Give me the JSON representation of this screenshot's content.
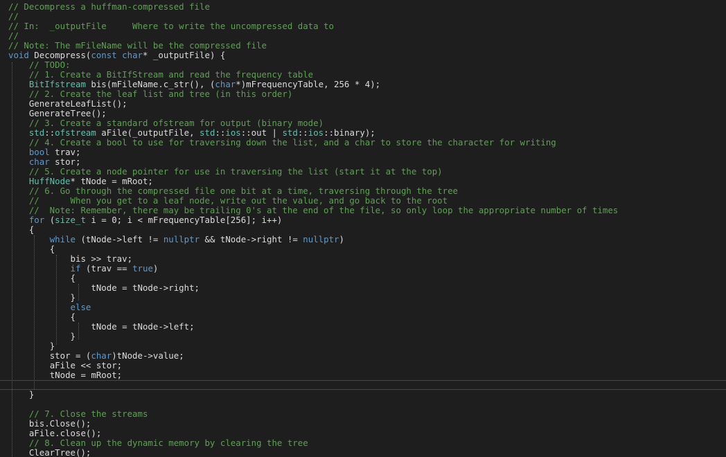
{
  "editor": {
    "theme_colors": {
      "background": "#1e1e1e",
      "comment": "#57a64a",
      "keyword": "#569cd6",
      "type": "#4ec9b0",
      "text": "#dcdcdc",
      "current_line_border": "#464646"
    },
    "current_line_index": 39,
    "lines": [
      {
        "indent": "",
        "tokens": [
          {
            "t": "// Decompress a huffman-compressed file",
            "c": "comment"
          }
        ]
      },
      {
        "indent": "",
        "tokens": [
          {
            "t": "//",
            "c": "comment"
          }
        ]
      },
      {
        "indent": "",
        "tokens": [
          {
            "t": "// In:  _outputFile     Where to write the uncompressed data to",
            "c": "comment"
          }
        ]
      },
      {
        "indent": "",
        "tokens": [
          {
            "t": "//",
            "c": "comment"
          }
        ]
      },
      {
        "indent": "",
        "tokens": [
          {
            "t": "// Note: The mFileName will be the compressed file",
            "c": "comment"
          }
        ]
      },
      {
        "indent": "",
        "tokens": [
          {
            "t": "void",
            "c": "keyword"
          },
          {
            "t": " Decompress(",
            "c": "text"
          },
          {
            "t": "const",
            "c": "keyword"
          },
          {
            "t": " ",
            "c": "text"
          },
          {
            "t": "char",
            "c": "keyword"
          },
          {
            "t": "* _outputFile) {",
            "c": "text"
          }
        ]
      },
      {
        "indent": "    ",
        "tokens": [
          {
            "t": "// TODO:",
            "c": "comment"
          }
        ]
      },
      {
        "indent": "    ",
        "tokens": [
          {
            "t": "// 1. Create a BitIfStream and read the frequency table",
            "c": "comment"
          }
        ]
      },
      {
        "indent": "    ",
        "tokens": [
          {
            "t": "BitIfstream",
            "c": "type"
          },
          {
            "t": " bis(mFileName.c_str(), (",
            "c": "text"
          },
          {
            "t": "char",
            "c": "keyword"
          },
          {
            "t": "*)mFrequencyTable, 256 * 4);",
            "c": "text"
          }
        ]
      },
      {
        "indent": "    ",
        "tokens": [
          {
            "t": "// 2. Create the leaf list and tree (in this order)",
            "c": "comment"
          }
        ]
      },
      {
        "indent": "    ",
        "tokens": [
          {
            "t": "GenerateLeafList();",
            "c": "text"
          }
        ]
      },
      {
        "indent": "    ",
        "tokens": [
          {
            "t": "GenerateTree();",
            "c": "text"
          }
        ]
      },
      {
        "indent": "    ",
        "tokens": [
          {
            "t": "// 3. Create a standard ofstream for output (binary mode)",
            "c": "comment"
          }
        ]
      },
      {
        "indent": "    ",
        "tokens": [
          {
            "t": "std",
            "c": "type"
          },
          {
            "t": "::",
            "c": "text"
          },
          {
            "t": "ofstream",
            "c": "type"
          },
          {
            "t": " aFile(_outputFile, ",
            "c": "text"
          },
          {
            "t": "std",
            "c": "type"
          },
          {
            "t": "::",
            "c": "text"
          },
          {
            "t": "ios",
            "c": "type"
          },
          {
            "t": "::out | ",
            "c": "text"
          },
          {
            "t": "std",
            "c": "type"
          },
          {
            "t": "::",
            "c": "text"
          },
          {
            "t": "ios",
            "c": "type"
          },
          {
            "t": "::binary);",
            "c": "text"
          }
        ]
      },
      {
        "indent": "    ",
        "tokens": [
          {
            "t": "// 4. Create a bool to use for traversing down the list, and a char to store the character for writing",
            "c": "comment"
          }
        ]
      },
      {
        "indent": "    ",
        "tokens": [
          {
            "t": "bool",
            "c": "keyword"
          },
          {
            "t": " trav;",
            "c": "text"
          }
        ]
      },
      {
        "indent": "    ",
        "tokens": [
          {
            "t": "char",
            "c": "keyword"
          },
          {
            "t": " stor;",
            "c": "text"
          }
        ]
      },
      {
        "indent": "    ",
        "tokens": [
          {
            "t": "// 5. Create a node pointer for use in traversing the list (start it at the top)",
            "c": "comment"
          }
        ]
      },
      {
        "indent": "    ",
        "tokens": [
          {
            "t": "HuffNode",
            "c": "type"
          },
          {
            "t": "* tNode = mRoot;",
            "c": "text"
          }
        ]
      },
      {
        "indent": "    ",
        "tokens": [
          {
            "t": "// 6. Go through the compressed file one bit at a time, traversing through the tree",
            "c": "comment"
          }
        ]
      },
      {
        "indent": "    ",
        "tokens": [
          {
            "t": "//      When you get to a leaf node, write out the value, and go back to the root",
            "c": "comment"
          }
        ]
      },
      {
        "indent": "    ",
        "tokens": [
          {
            "t": "//  Note: Remember, there may be trailing 0's at the end of the file, so only loop the appropriate number of times",
            "c": "comment"
          }
        ]
      },
      {
        "indent": "    ",
        "tokens": [
          {
            "t": "for",
            "c": "keyword"
          },
          {
            "t": " (",
            "c": "text"
          },
          {
            "t": "size_t",
            "c": "type"
          },
          {
            "t": " i = 0; i < mFrequencyTable[256]; i++)",
            "c": "text"
          }
        ]
      },
      {
        "indent": "    ",
        "tokens": [
          {
            "t": "{",
            "c": "text"
          }
        ]
      },
      {
        "indent": "        ",
        "tokens": [
          {
            "t": "while",
            "c": "keyword"
          },
          {
            "t": " (tNode->left != ",
            "c": "text"
          },
          {
            "t": "nullptr",
            "c": "keyword"
          },
          {
            "t": " && tNode->right != ",
            "c": "text"
          },
          {
            "t": "nullptr",
            "c": "keyword"
          },
          {
            "t": ")",
            "c": "text"
          }
        ]
      },
      {
        "indent": "        ",
        "tokens": [
          {
            "t": "{",
            "c": "text"
          }
        ]
      },
      {
        "indent": "            ",
        "tokens": [
          {
            "t": "bis >> trav;",
            "c": "text"
          }
        ]
      },
      {
        "indent": "            ",
        "tokens": [
          {
            "t": "if",
            "c": "keyword"
          },
          {
            "t": " (trav == ",
            "c": "text"
          },
          {
            "t": "true",
            "c": "keyword"
          },
          {
            "t": ")",
            "c": "text"
          }
        ]
      },
      {
        "indent": "            ",
        "tokens": [
          {
            "t": "{",
            "c": "text"
          }
        ]
      },
      {
        "indent": "                ",
        "tokens": [
          {
            "t": "tNode = tNode->right;",
            "c": "text"
          }
        ]
      },
      {
        "indent": "            ",
        "tokens": [
          {
            "t": "}",
            "c": "text"
          }
        ]
      },
      {
        "indent": "            ",
        "tokens": [
          {
            "t": "else",
            "c": "keyword"
          }
        ]
      },
      {
        "indent": "            ",
        "tokens": [
          {
            "t": "{",
            "c": "text"
          }
        ]
      },
      {
        "indent": "                ",
        "tokens": [
          {
            "t": "tNode = tNode->left;",
            "c": "text"
          }
        ]
      },
      {
        "indent": "            ",
        "tokens": [
          {
            "t": "}",
            "c": "text"
          }
        ]
      },
      {
        "indent": "        ",
        "tokens": [
          {
            "t": "}",
            "c": "text"
          }
        ]
      },
      {
        "indent": "        ",
        "tokens": [
          {
            "t": "stor = (",
            "c": "text"
          },
          {
            "t": "char",
            "c": "keyword"
          },
          {
            "t": ")tNode->value;",
            "c": "text"
          }
        ]
      },
      {
        "indent": "        ",
        "tokens": [
          {
            "t": "aFile << stor;",
            "c": "text"
          }
        ]
      },
      {
        "indent": "        ",
        "tokens": [
          {
            "t": "tNode = mRoot;",
            "c": "text"
          }
        ]
      },
      {
        "indent": "",
        "tokens": []
      },
      {
        "indent": "    ",
        "tokens": [
          {
            "t": "}",
            "c": "text"
          }
        ]
      },
      {
        "indent": "",
        "tokens": []
      },
      {
        "indent": "    ",
        "tokens": [
          {
            "t": "// 7. Close the streams",
            "c": "comment"
          }
        ]
      },
      {
        "indent": "    ",
        "tokens": [
          {
            "t": "bis.Close();",
            "c": "text"
          }
        ]
      },
      {
        "indent": "    ",
        "tokens": [
          {
            "t": "aFile.close();",
            "c": "text"
          }
        ]
      },
      {
        "indent": "    ",
        "tokens": [
          {
            "t": "// 8. Clean up the dynamic memory by clearing the tree",
            "c": "comment"
          }
        ]
      },
      {
        "indent": "    ",
        "tokens": [
          {
            "t": "ClearTree();",
            "c": "text"
          }
        ]
      }
    ]
  }
}
